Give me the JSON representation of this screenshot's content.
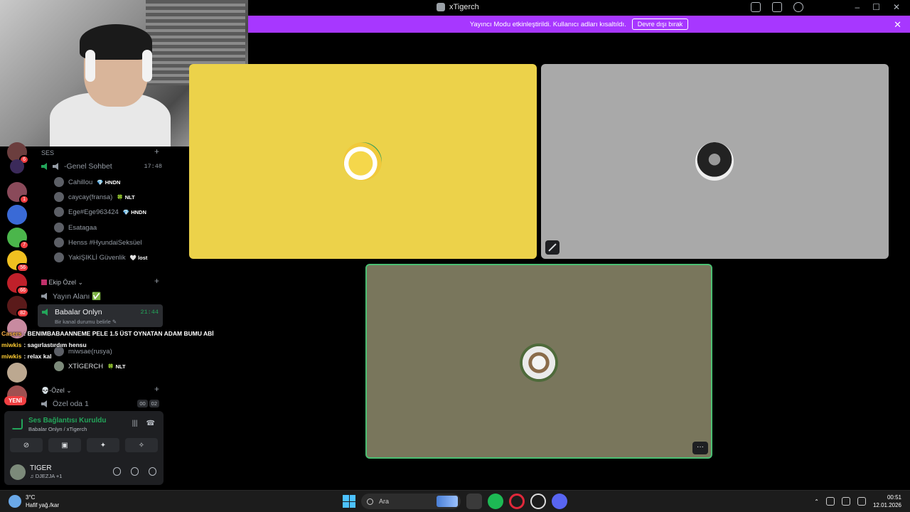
{
  "window": {
    "title": "xTigerch"
  },
  "banner": {
    "message": "Yayıncı Modu etkinleştirildi. Kullanıcı adları kısaltıldı.",
    "button_label": "Devre dışı bırak",
    "close_glyph": "✕"
  },
  "servers": [
    {
      "badge": "6"
    },
    {
      "badge": ""
    },
    {
      "badge": "1"
    },
    {
      "badge": ""
    },
    {
      "badge": "7"
    },
    {
      "badge": "56"
    },
    {
      "badge": "66"
    },
    {
      "badge": "82"
    },
    {
      "badge": ""
    },
    {
      "badge": ""
    },
    {
      "badge": ""
    }
  ],
  "new_label": "YENİ",
  "channels": {
    "section_voice": "SES",
    "genel": {
      "name": "-Genel Sohbet",
      "time": "17:48"
    },
    "genel_users": [
      {
        "name": "Cahillou",
        "tag": "💎 HNDN"
      },
      {
        "name": "caycay(fransa)",
        "tag": "🍀 NLT"
      },
      {
        "name": "Ege#Ege963424",
        "tag": "💎 HNDN"
      },
      {
        "name": "Esatagaa",
        "tag": ""
      },
      {
        "name": "Henss #HyundaiSeksüel",
        "tag": ""
      },
      {
        "name": "YakiŞIKLİ Güvenlik",
        "tag": "🤍 lost"
      }
    ],
    "section_ekip": "Ekip Özel",
    "yayin": {
      "name": "Yayın Alanı ✅"
    },
    "active": {
      "name": "Babalar Onlyn",
      "sub": "Bir kanal durumu belirle ✎",
      "time": "21:44"
    },
    "active_users": [
      {
        "name": "miwsae(rusya)",
        "tag": ""
      },
      {
        "name": "XTİGERCH",
        "tag": "🍀 NLT"
      }
    ],
    "section_ozel": "💀-Özel",
    "ozel1": {
      "name": "Özel oda 1",
      "count_a": "00",
      "count_b": "02"
    }
  },
  "chat_overlay": [
    {
      "user": "Casers",
      "text": ": BENIMBABAANNEME PELE 1.5 ÜST OYNATAN ADAM BUMU ABİ"
    },
    {
      "user": "miwkis",
      "text": ": sagırlastırdım hensu"
    },
    {
      "user": "miwkis",
      "text": ": relax kal"
    }
  ],
  "voice_panel": {
    "status": "Ses Bağlantısı Kuruldu",
    "location": "Babalar Onlyn / xTigerch",
    "user_name": "TIGER",
    "user_status": "♫ DJEZJA +1"
  },
  "tiles": {
    "more_label": "···"
  },
  "taskbar": {
    "temp": "3°C",
    "weather": "Hafif yağ./kar",
    "search_placeholder": "Ara",
    "time": "00:51",
    "date": "12.01.2026"
  },
  "colors": {
    "accent_banner": "#a737ff",
    "speaking_green": "#23a55a",
    "tile1": "#ecd24a",
    "tile2": "#a9a9a9",
    "tile3": "#79765c"
  }
}
